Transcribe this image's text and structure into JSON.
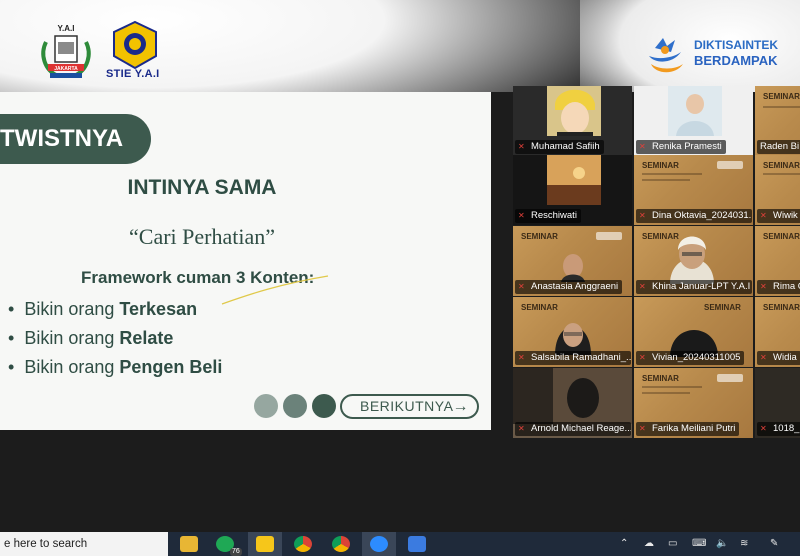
{
  "header": {
    "yai_logo_text": "Y.A.I",
    "yai_logo_city": "JAKARTA",
    "stie_name": "STIE Y.A.I",
    "dikti_line1": "DIKTISAINTEK",
    "dikti_line2": "BERDAMPAK"
  },
  "slide": {
    "section_pill": "TWISTNYA",
    "heading": "INTINYA SAMA",
    "quote": "“Cari Perhatian”",
    "framework_title": "Framework cuman 3 Konten:",
    "bullets": [
      {
        "prefix": "Bikin orang ",
        "bold": "Terkesan"
      },
      {
        "prefix": "Bikin orang ",
        "bold": "Relate"
      },
      {
        "prefix": "Bikin orang ",
        "bold": "Pengen Beli"
      }
    ],
    "next_button": "BERIKUTNYA"
  },
  "participants": [
    {
      "name": "Muhamad Safiih"
    },
    {
      "name": "Renika Pramesti"
    },
    {
      "name": "Raden Bi"
    },
    {
      "name": "Reschiwati"
    },
    {
      "name": "Dina Oktavia_2024031..."
    },
    {
      "name": "Wiwik"
    },
    {
      "name": "Anastasia Anggraeni"
    },
    {
      "name": "Khina Januar-LPT Y.A.I"
    },
    {
      "name": "Rima C"
    },
    {
      "name": "Salsabila Ramadhani_..."
    },
    {
      "name": "Vivian_20240311005"
    },
    {
      "name": "Widia"
    },
    {
      "name": "Arnold Michael Reage..."
    },
    {
      "name": "Farika Meiliani Putri"
    },
    {
      "name": "1018_"
    }
  ],
  "seminar_label": "SEMINAR",
  "taskbar": {
    "search_placeholder": "e here to search",
    "whatsapp_badge": "76"
  }
}
